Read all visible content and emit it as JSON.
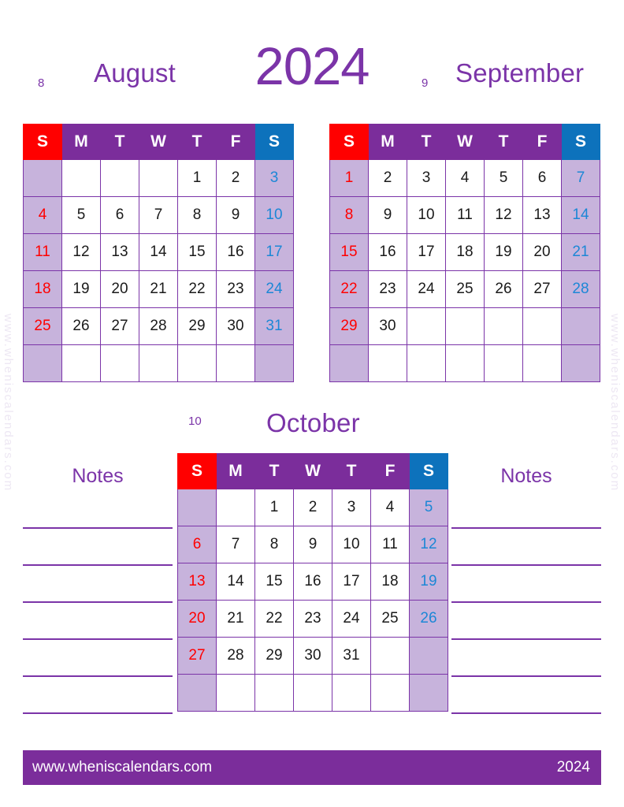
{
  "page": {
    "year_title": "2024",
    "accent_purple": "#7B34A8",
    "header_purple": "#7B2D9B",
    "sunday_red": "#FF0000",
    "saturday_blue": "#0D72BC",
    "weekend_cell": "#C7B3DC",
    "watermark_text": "www.wheniscalendars.com"
  },
  "footer": {
    "url": "www.wheniscalendars.com",
    "year": "2024"
  },
  "weekday_headers": [
    "S",
    "M",
    "T",
    "W",
    "T",
    "F",
    "S"
  ],
  "notes": {
    "left_label": "Notes",
    "right_label": "Notes",
    "line_count": 6
  },
  "months": [
    {
      "number": "8",
      "name": "August",
      "weeks": [
        [
          "",
          "",
          "",
          "",
          "1",
          "2",
          "3"
        ],
        [
          "4",
          "5",
          "6",
          "7",
          "8",
          "9",
          "10"
        ],
        [
          "11",
          "12",
          "13",
          "14",
          "15",
          "16",
          "17"
        ],
        [
          "18",
          "19",
          "20",
          "21",
          "22",
          "23",
          "24"
        ],
        [
          "25",
          "26",
          "27",
          "28",
          "29",
          "30",
          "31"
        ],
        [
          "",
          "",
          "",
          "",
          "",
          "",
          ""
        ]
      ]
    },
    {
      "number": "9",
      "name": "September",
      "weeks": [
        [
          "1",
          "2",
          "3",
          "4",
          "5",
          "6",
          "7"
        ],
        [
          "8",
          "9",
          "10",
          "11",
          "12",
          "13",
          "14"
        ],
        [
          "15",
          "16",
          "17",
          "18",
          "19",
          "20",
          "21"
        ],
        [
          "22",
          "23",
          "24",
          "25",
          "26",
          "27",
          "28"
        ],
        [
          "29",
          "30",
          "",
          "",
          "",
          "",
          ""
        ],
        [
          "",
          "",
          "",
          "",
          "",
          "",
          ""
        ]
      ]
    },
    {
      "number": "10",
      "name": "October",
      "weeks": [
        [
          "",
          "",
          "1",
          "2",
          "3",
          "4",
          "5"
        ],
        [
          "6",
          "7",
          "8",
          "9",
          "10",
          "11",
          "12"
        ],
        [
          "13",
          "14",
          "15",
          "16",
          "17",
          "18",
          "19"
        ],
        [
          "20",
          "21",
          "22",
          "23",
          "24",
          "25",
          "26"
        ],
        [
          "27",
          "28",
          "29",
          "30",
          "31",
          "",
          ""
        ],
        [
          "",
          "",
          "",
          "",
          "",
          "",
          ""
        ]
      ]
    }
  ]
}
